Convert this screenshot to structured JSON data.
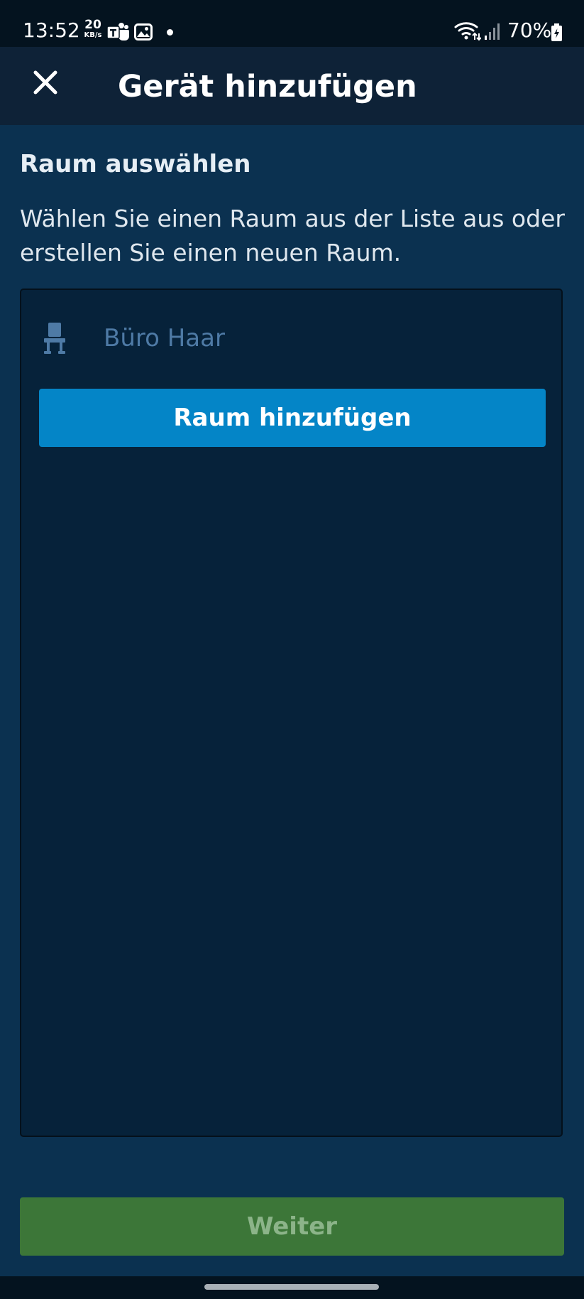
{
  "status_bar": {
    "time": "13:52",
    "net_speed_value": "20",
    "net_speed_unit": "KB/s",
    "battery": "70%",
    "icons": [
      "teams-icon",
      "gallery-icon",
      "notification-dot",
      "wifi-icon",
      "signal-icon",
      "battery-icon"
    ]
  },
  "app_bar": {
    "close_icon": "close-icon",
    "title": "Gerät hinzufügen"
  },
  "content": {
    "section_title": "Raum auswählen",
    "description": "Wählen Sie einen Raum aus der Liste aus oder erstellen Sie einen neuen Raum.",
    "rooms": [
      {
        "icon": "chair-icon",
        "name": "Büro Haar"
      }
    ],
    "add_room_label": "Raum hinzufügen"
  },
  "footer": {
    "next_label": "Weiter"
  },
  "colors": {
    "background": "#0b3150",
    "app_bar": "#0e2237",
    "panel": "#06223a",
    "add_button": "#0485c7",
    "next_button": "#3c7638",
    "room_text": "#4e7aa5"
  }
}
